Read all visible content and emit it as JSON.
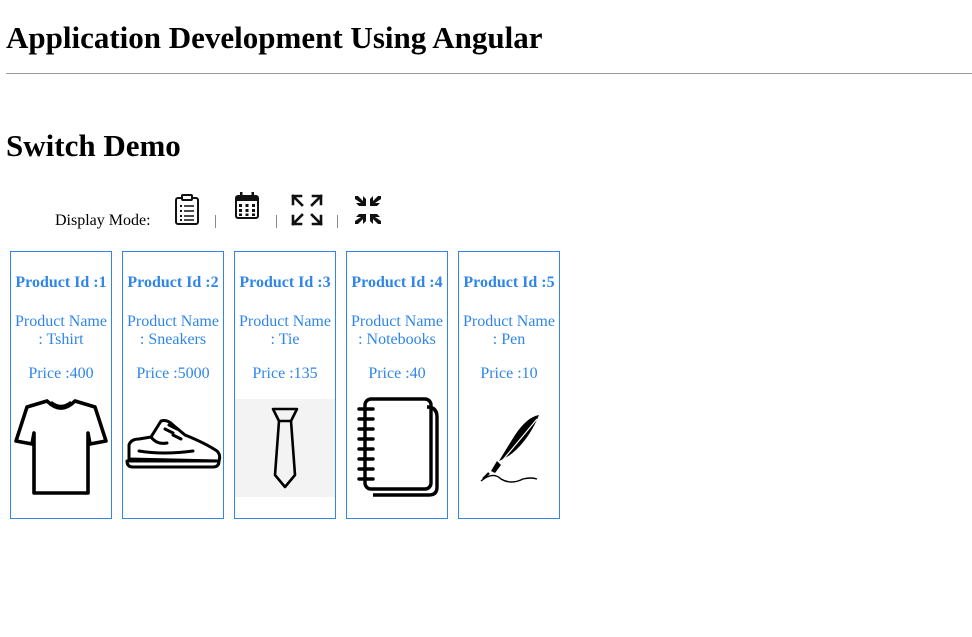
{
  "header": {
    "title": "Application Development Using Angular"
  },
  "section": {
    "title": "Switch Demo"
  },
  "toolbar": {
    "label": "Display Mode:",
    "separator": "|",
    "buttons": [
      {
        "icon": "clipboard-list-icon"
      },
      {
        "icon": "calendar-icon"
      },
      {
        "icon": "expand-icon"
      },
      {
        "icon": "compress-icon"
      }
    ]
  },
  "products": [
    {
      "id_text": "Product Id :1",
      "name_line1": "Product Name",
      "name_line2": ": Tshirt",
      "price_text": "Price :400",
      "icon": "tshirt-icon"
    },
    {
      "id_text": "Product Id :2",
      "name_line1": "Product Name",
      "name_line2": ": Sneakers",
      "price_text": "Price :5000",
      "icon": "sneaker-icon"
    },
    {
      "id_text": "Product Id :3",
      "name_line1": "Product Name",
      "name_line2": ": Tie",
      "price_text": "Price :135",
      "icon": "tie-icon"
    },
    {
      "id_text": "Product Id :4",
      "name_line1": "Product Name",
      "name_line2": ": Notebooks",
      "price_text": "Price :40",
      "icon": "notebook-icon"
    },
    {
      "id_text": "Product Id :5",
      "name_line1": "Product Name",
      "name_line2": ": Pen",
      "price_text": "Price :10",
      "icon": "quill-pen-icon"
    }
  ],
  "colors": {
    "accent": "#2f86e8",
    "tie_background": "#f3f3f3"
  }
}
